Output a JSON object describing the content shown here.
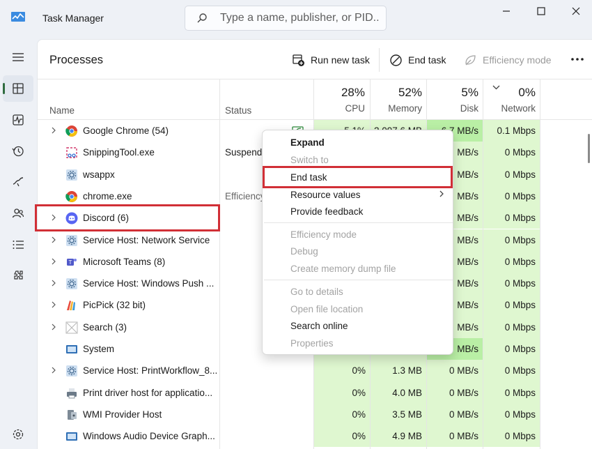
{
  "window": {
    "title": "Task Manager",
    "search_placeholder": "Type a name, publisher, or PID..."
  },
  "nav": {
    "items": [
      "hamburger-icon",
      "processes-icon",
      "performance-icon",
      "app-history-icon",
      "startup-apps-icon",
      "users-icon",
      "details-icon",
      "services-icon",
      "settings-icon"
    ],
    "active": "processes"
  },
  "toolbar": {
    "page_title": "Processes",
    "run_new_task": "Run new task",
    "end_task": "End task",
    "efficiency_mode": "Efficiency mode"
  },
  "columns": {
    "name": "Name",
    "status": "Status",
    "cpu": {
      "pct": "28%",
      "label": "CPU"
    },
    "memory": {
      "pct": "52%",
      "label": "Memory"
    },
    "disk": {
      "pct": "5%",
      "label": "Disk"
    },
    "network": {
      "pct": "0%",
      "label": "Network"
    }
  },
  "processes": [
    {
      "name": "Google Chrome (54)",
      "icon": "chrome-icon",
      "expandable": true,
      "status": "",
      "cpu": "5.1%",
      "memory": "2,097.6 MB",
      "disk": "6.7 MB/s",
      "network": "0.1 Mbps"
    },
    {
      "name": "SnippingTool.exe",
      "icon": "snipping-tool-icon",
      "expandable": false,
      "status": "Suspende",
      "cpu": "",
      "memory": "",
      "disk": "MB/s",
      "network": "0 Mbps"
    },
    {
      "name": "wsappx",
      "icon": "gear-app-icon",
      "expandable": false,
      "status": "",
      "cpu": "",
      "memory": "",
      "disk": "MB/s",
      "network": "0 Mbps"
    },
    {
      "name": "chrome.exe",
      "icon": "chrome-icon",
      "expandable": false,
      "status": "Efficiency",
      "cpu": "",
      "memory": "",
      "disk": "MB/s",
      "network": "0 Mbps"
    },
    {
      "name": "Discord (6)",
      "icon": "discord-icon",
      "expandable": true,
      "status": "",
      "cpu": "",
      "memory": "",
      "disk": "MB/s",
      "network": "0 Mbps"
    },
    {
      "name": "Service Host: Network Service",
      "icon": "gear-app-icon",
      "expandable": true,
      "status": "",
      "cpu": "",
      "memory": "",
      "disk": "MB/s",
      "network": "0 Mbps"
    },
    {
      "name": "Microsoft Teams (8)",
      "icon": "teams-icon",
      "expandable": true,
      "status": "",
      "cpu": "",
      "memory": "",
      "disk": "MB/s",
      "network": "0 Mbps"
    },
    {
      "name": "Service Host: Windows Push ...",
      "icon": "gear-app-icon",
      "expandable": true,
      "status": "",
      "cpu": "",
      "memory": "",
      "disk": "MB/s",
      "network": "0 Mbps"
    },
    {
      "name": "PicPick (32 bit)",
      "icon": "picpick-icon",
      "expandable": true,
      "status": "",
      "cpu": "",
      "memory": "",
      "disk": "MB/s",
      "network": "0 Mbps"
    },
    {
      "name": "Search (3)",
      "icon": "search-app-icon",
      "expandable": true,
      "status": "",
      "cpu": "",
      "memory": "",
      "disk": "MB/s",
      "network": "0 Mbps"
    },
    {
      "name": "System",
      "icon": "system-icon",
      "expandable": false,
      "status": "",
      "cpu": "",
      "memory": "",
      "disk": "MB/s",
      "network": "0 Mbps"
    },
    {
      "name": "Service Host: PrintWorkflow_8...",
      "icon": "gear-app-icon",
      "expandable": true,
      "status": "",
      "cpu": "0%",
      "memory": "1.3 MB",
      "disk": "0 MB/s",
      "network": "0 Mbps"
    },
    {
      "name": "Print driver host for applicatio...",
      "icon": "printer-icon",
      "expandable": false,
      "status": "",
      "cpu": "0%",
      "memory": "4.0 MB",
      "disk": "0 MB/s",
      "network": "0 Mbps"
    },
    {
      "name": "WMI Provider Host",
      "icon": "wmi-icon",
      "expandable": false,
      "status": "",
      "cpu": "0%",
      "memory": "3.5 MB",
      "disk": "0 MB/s",
      "network": "0 Mbps"
    },
    {
      "name": "Windows Audio Device Graph...",
      "icon": "system-icon",
      "expandable": false,
      "status": "",
      "cpu": "0%",
      "memory": "4.9 MB",
      "disk": "0 MB/s",
      "network": "0 Mbps"
    }
  ],
  "context_menu": {
    "expand": "Expand",
    "switch_to": "Switch to",
    "end_task": "End task",
    "resource_values": "Resource values",
    "provide_feedback": "Provide feedback",
    "efficiency_mode": "Efficiency mode",
    "debug": "Debug",
    "create_dump": "Create memory dump file",
    "go_to_details": "Go to details",
    "open_file_location": "Open file location",
    "search_online": "Search online",
    "properties": "Properties"
  },
  "colors": {
    "highlight": "#d12f36",
    "usage_light": "#dff7d0",
    "usage_medium": "#b9efa5",
    "accent": "#2f6b3f"
  }
}
